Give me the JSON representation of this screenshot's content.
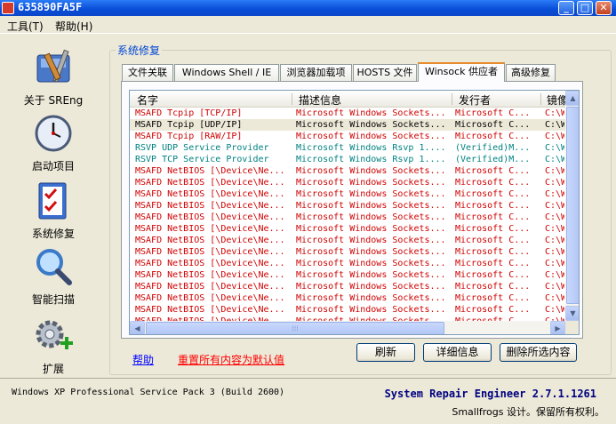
{
  "window": {
    "title": "635890FA5F",
    "minimize": "_",
    "maximize": "□",
    "close": "✕"
  },
  "menu": [
    {
      "label": "工具(T)"
    },
    {
      "label": "帮助(H)"
    }
  ],
  "sidebar": {
    "items": [
      {
        "label": "关于 SREng",
        "icon": "toolbox-icon"
      },
      {
        "label": "启动项目",
        "icon": "clock-icon"
      },
      {
        "label": "系统修复",
        "icon": "checklist-icon"
      },
      {
        "label": "智能扫描",
        "icon": "magnifier-icon"
      },
      {
        "label": "扩展",
        "icon": "gear-plus-icon"
      }
    ]
  },
  "group_title": "系统修复",
  "tabs": [
    {
      "label": "文件关联"
    },
    {
      "label": "Windows Shell / IE"
    },
    {
      "label": "浏览器加载项"
    },
    {
      "label": "HOSTS 文件"
    },
    {
      "label": "Winsock 供应者",
      "active": true
    },
    {
      "label": "高级修复"
    }
  ],
  "list": {
    "columns": [
      "名字",
      "描述信息",
      "发行者",
      "镜像"
    ],
    "rows": [
      {
        "name": "MSAFD Tcpip [TCP/IP]",
        "desc": "Microsoft Windows Sockets...",
        "pub": "Microsoft C...",
        "path": "C:\\W",
        "kind": "ms"
      },
      {
        "name": "MSAFD Tcpip [UDP/IP]",
        "desc": "Microsoft Windows Sockets...",
        "pub": "Microsoft C...",
        "path": "C:\\W",
        "kind": "ms",
        "selected": true
      },
      {
        "name": "MSAFD Tcpip [RAW/IP]",
        "desc": "Microsoft Windows Sockets...",
        "pub": "Microsoft C...",
        "path": "C:\\W",
        "kind": "ms"
      },
      {
        "name": "RSVP UDP Service Provider",
        "desc": "Microsoft Windows Rsvp 1....",
        "pub": "(Verified)M...",
        "path": "C:\\W",
        "kind": "rsvp"
      },
      {
        "name": "RSVP TCP Service Provider",
        "desc": "Microsoft Windows Rsvp 1....",
        "pub": "(Verified)M...",
        "path": "C:\\W",
        "kind": "rsvp"
      },
      {
        "name": "MSAFD NetBIOS [\\Device\\Ne...",
        "desc": "Microsoft Windows Sockets...",
        "pub": "Microsoft C...",
        "path": "C:\\W",
        "kind": "ms"
      },
      {
        "name": "MSAFD NetBIOS [\\Device\\Ne...",
        "desc": "Microsoft Windows Sockets...",
        "pub": "Microsoft C...",
        "path": "C:\\W",
        "kind": "ms"
      },
      {
        "name": "MSAFD NetBIOS [\\Device\\Ne...",
        "desc": "Microsoft Windows Sockets...",
        "pub": "Microsoft C...",
        "path": "C:\\W",
        "kind": "ms"
      },
      {
        "name": "MSAFD NetBIOS [\\Device\\Ne...",
        "desc": "Microsoft Windows Sockets...",
        "pub": "Microsoft C...",
        "path": "C:\\W",
        "kind": "ms"
      },
      {
        "name": "MSAFD NetBIOS [\\Device\\Ne...",
        "desc": "Microsoft Windows Sockets...",
        "pub": "Microsoft C...",
        "path": "C:\\W",
        "kind": "ms"
      },
      {
        "name": "MSAFD NetBIOS [\\Device\\Ne...",
        "desc": "Microsoft Windows Sockets...",
        "pub": "Microsoft C...",
        "path": "C:\\W",
        "kind": "ms"
      },
      {
        "name": "MSAFD NetBIOS [\\Device\\Ne...",
        "desc": "Microsoft Windows Sockets...",
        "pub": "Microsoft C...",
        "path": "C:\\W",
        "kind": "ms"
      },
      {
        "name": "MSAFD NetBIOS [\\Device\\Ne...",
        "desc": "Microsoft Windows Sockets...",
        "pub": "Microsoft C...",
        "path": "C:\\W",
        "kind": "ms"
      },
      {
        "name": "MSAFD NetBIOS [\\Device\\Ne...",
        "desc": "Microsoft Windows Sockets...",
        "pub": "Microsoft C...",
        "path": "C:\\W",
        "kind": "ms"
      },
      {
        "name": "MSAFD NetBIOS [\\Device\\Ne...",
        "desc": "Microsoft Windows Sockets...",
        "pub": "Microsoft C...",
        "path": "C:\\W",
        "kind": "ms"
      },
      {
        "name": "MSAFD NetBIOS [\\Device\\Ne...",
        "desc": "Microsoft Windows Sockets...",
        "pub": "Microsoft C...",
        "path": "C:\\W",
        "kind": "ms"
      },
      {
        "name": "MSAFD NetBIOS [\\Device\\Ne...",
        "desc": "Microsoft Windows Sockets...",
        "pub": "Microsoft C...",
        "path": "C:\\W",
        "kind": "ms"
      },
      {
        "name": "MSAFD NetBIOS [\\Device\\Ne...",
        "desc": "Microsoft Windows Sockets...",
        "pub": "Microsoft C...",
        "path": "C:\\W",
        "kind": "ms"
      },
      {
        "name": "MSAFD NetBIOS [\\Device\\Ne...",
        "desc": "Microsoft Windows Sockets...",
        "pub": "Microsoft C...",
        "path": "C:\\W",
        "kind": "ms"
      }
    ]
  },
  "links": {
    "help": "帮助",
    "reset": "重置所有内容为默认值"
  },
  "buttons": {
    "refresh": "刷新",
    "details": "详细信息",
    "delete": "删除所选内容"
  },
  "status": {
    "os": "Windows XP Professional Service Pack 3 (Build 2600)",
    "product": "System Repair Engineer 2.7.1.1261",
    "copyright": "Smallfrogs 设计。保留所有权利。"
  },
  "colors": {
    "link_blue": "#0000ff",
    "link_red": "#ff0000",
    "ms_row": "#d00000",
    "rsvp_row": "#008080",
    "tab_accent": "#e68b2c"
  }
}
